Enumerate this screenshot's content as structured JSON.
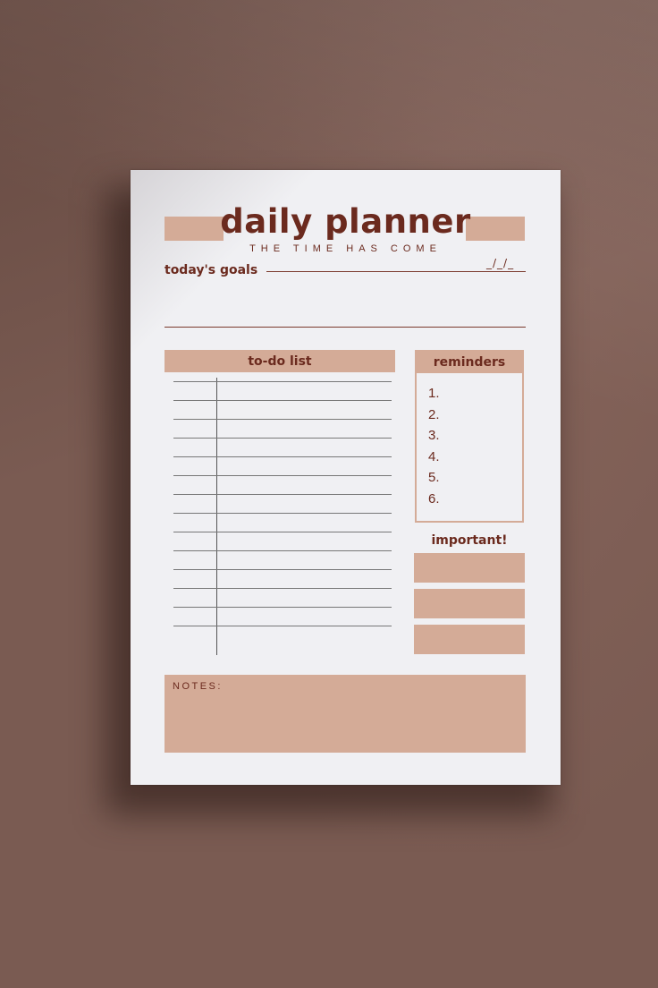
{
  "planner": {
    "title": "daily planner",
    "subtitle": "THE TIME HAS COME",
    "goals_label": "today's goals",
    "date_placeholder": "_/_/_",
    "todo_header": "to-do list",
    "todo_rows": 14,
    "reminders_header": "reminders",
    "reminders": [
      "1.",
      "2.",
      "3.",
      "4.",
      "5.",
      "6."
    ],
    "important_label": "important!",
    "important_boxes": 3,
    "notes_label": "NOTES:"
  },
  "colors": {
    "accent": "#d4ab97",
    "text": "#6b2a1e",
    "paper": "#f0f0f3",
    "background": "#7a5b52"
  }
}
